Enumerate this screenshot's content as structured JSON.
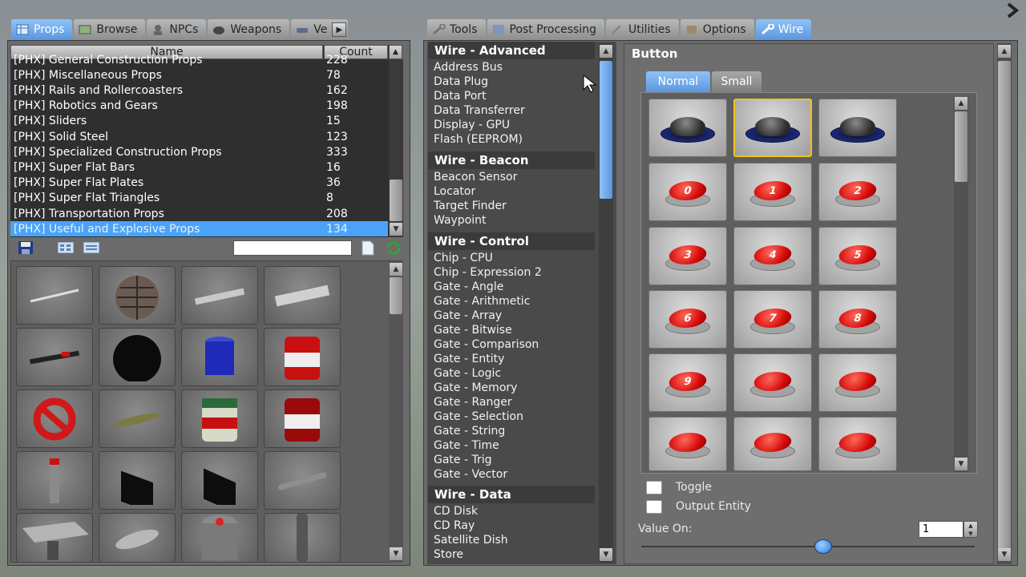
{
  "left_tabs": [
    {
      "label": "Props",
      "active": true
    },
    {
      "label": "Browse",
      "active": false
    },
    {
      "label": "NPCs",
      "active": false
    },
    {
      "label": "Weapons",
      "active": false
    },
    {
      "label": "Ve",
      "active": false
    }
  ],
  "right_tabs": [
    {
      "label": "Tools",
      "active": false
    },
    {
      "label": "Post Processing",
      "active": false
    },
    {
      "label": "Utilities",
      "active": false
    },
    {
      "label": "Options",
      "active": false
    },
    {
      "label": "Wire",
      "active": true
    }
  ],
  "props_list": {
    "header_name": "Name",
    "header_count": "Count",
    "rows": [
      {
        "name": "[PHX] General Construction Props",
        "count": "228"
      },
      {
        "name": "[PHX] Miscellaneous Props",
        "count": "78"
      },
      {
        "name": "[PHX] Rails and Rollercoasters",
        "count": "162"
      },
      {
        "name": "[PHX] Robotics and Gears",
        "count": "198"
      },
      {
        "name": "[PHX] Sliders",
        "count": "15"
      },
      {
        "name": "[PHX] Solid Steel",
        "count": "123"
      },
      {
        "name": "[PHX] Specialized Construction Props",
        "count": "333"
      },
      {
        "name": "[PHX] Super Flat Bars",
        "count": "16"
      },
      {
        "name": "[PHX] Super Flat Plates",
        "count": "36"
      },
      {
        "name": "[PHX] Super Flat Triangles",
        "count": "8"
      },
      {
        "name": "[PHX] Transportation Props",
        "count": "208"
      },
      {
        "name": "[PHX] Useful and Explosive Props",
        "count": "134"
      }
    ],
    "selected_index": 11,
    "search_value": ""
  },
  "wire_tools": [
    {
      "category": "Wire - Advanced",
      "items": [
        "Address Bus",
        "Data Plug",
        "Data Port",
        "Data Transferrer",
        "Display - GPU",
        "Flash (EEPROM)"
      ]
    },
    {
      "category": "Wire - Beacon",
      "items": [
        "Beacon Sensor",
        "Locator",
        "Target Finder",
        "Waypoint"
      ]
    },
    {
      "category": "Wire - Control",
      "items": [
        "Chip - CPU",
        "Chip - Expression 2",
        "Gate - Angle",
        "Gate - Arithmetic",
        "Gate - Array",
        "Gate - Bitwise",
        "Gate - Comparison",
        "Gate - Entity",
        "Gate - Logic",
        "Gate - Memory",
        "Gate - Ranger",
        "Gate - Selection",
        "Gate - String",
        "Gate - Time",
        "Gate - Trig",
        "Gate - Vector"
      ]
    },
    {
      "category": "Wire - Data",
      "items": [
        "CD Disk",
        "CD Ray",
        "Satellite Dish",
        "Store"
      ]
    }
  ],
  "button_panel": {
    "title": "Button",
    "subtabs": [
      {
        "label": "Normal",
        "active": true
      },
      {
        "label": "Small",
        "active": false
      }
    ],
    "buttons": [
      {
        "kind": "black",
        "label": ""
      },
      {
        "kind": "black",
        "label": "",
        "selected": true
      },
      {
        "kind": "black",
        "label": ""
      },
      {
        "kind": "red",
        "label": "0"
      },
      {
        "kind": "red",
        "label": "1"
      },
      {
        "kind": "red",
        "label": "2"
      },
      {
        "kind": "red",
        "label": "3"
      },
      {
        "kind": "red",
        "label": "4"
      },
      {
        "kind": "red",
        "label": "5"
      },
      {
        "kind": "red",
        "label": "6"
      },
      {
        "kind": "red",
        "label": "7"
      },
      {
        "kind": "red",
        "label": "8"
      },
      {
        "kind": "red",
        "label": "9"
      },
      {
        "kind": "red",
        "label": ""
      },
      {
        "kind": "red",
        "label": ""
      },
      {
        "kind": "red",
        "label": ""
      },
      {
        "kind": "red",
        "label": ""
      },
      {
        "kind": "red",
        "label": ""
      }
    ],
    "toggle_label": "Toggle",
    "toggle_checked": false,
    "output_entity_label": "Output Entity",
    "output_entity_checked": false,
    "value_on_label": "Value On:",
    "value_on": "1"
  },
  "colors": {
    "accent": "#4aa3f7",
    "panel": "#6b6b6b",
    "list_bg": "#2f2f2f",
    "selected_border": "#f2c417",
    "button_red": "#d60c0c"
  }
}
